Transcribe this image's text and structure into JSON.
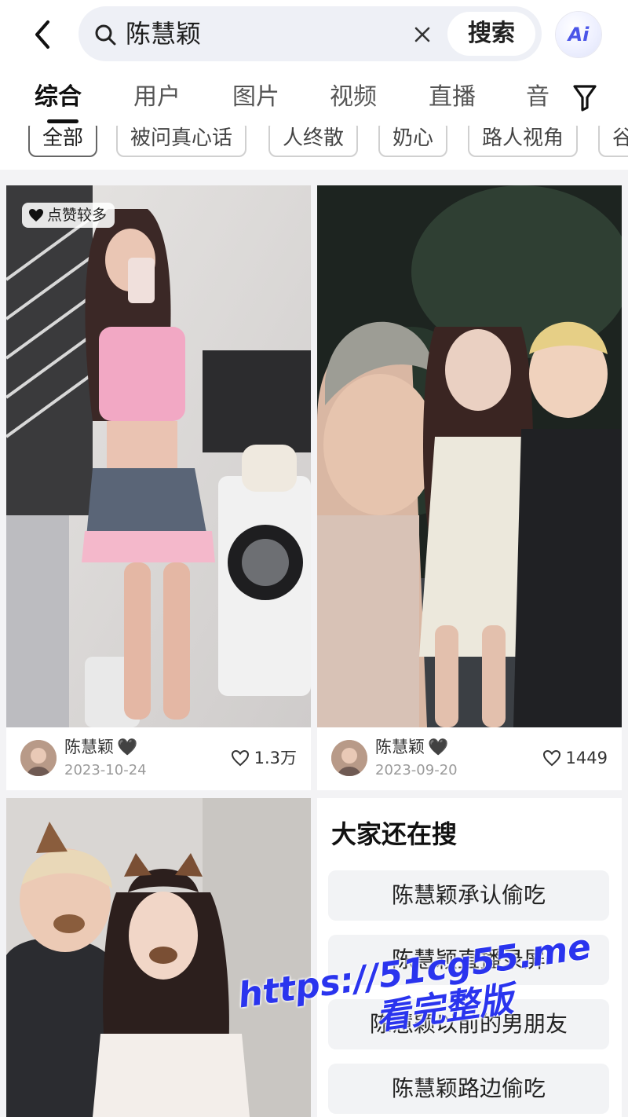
{
  "search": {
    "query": "陈慧颖",
    "button_label": "搜索",
    "ai_label": "Ai"
  },
  "tabs": [
    {
      "label": "综合",
      "active": true
    },
    {
      "label": "用户",
      "active": false
    },
    {
      "label": "图片",
      "active": false
    },
    {
      "label": "视频",
      "active": false
    },
    {
      "label": "直播",
      "active": false
    },
    {
      "label": "音",
      "active": false
    }
  ],
  "chips": [
    {
      "label": "全部",
      "active": true
    },
    {
      "label": "被问真心话",
      "active": false
    },
    {
      "label": "人终散",
      "active": false
    },
    {
      "label": "奶心",
      "active": false
    },
    {
      "label": "路人视角",
      "active": false
    },
    {
      "label": "谷",
      "active": false
    }
  ],
  "posts": [
    {
      "badge": "点赞较多",
      "author": "陈慧颖",
      "author_emoji": "🖤",
      "date": "2023-10-24",
      "likes": "1.3万"
    },
    {
      "author": "陈慧颖",
      "author_emoji": "🖤",
      "date": "2023-09-20",
      "likes": "1449"
    }
  ],
  "related": {
    "title": "大家还在搜",
    "items": [
      "陈慧颖承认偷吃",
      "陈慧颖直播录屏",
      "陈慧颖以前的男朋友",
      "陈慧颖路边偷吃"
    ]
  },
  "watermark": {
    "url": "https://51cg55.me",
    "subtitle": "看完整版"
  },
  "colors": {
    "accent_watermark": "#2a34ee",
    "ai_icon": "#4b56e8",
    "page_bg": "#f3f3f5"
  }
}
